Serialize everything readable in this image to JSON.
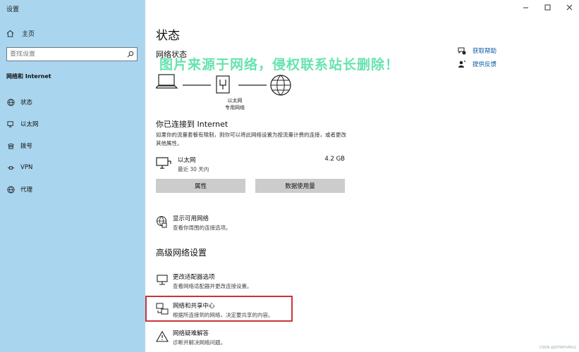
{
  "window": {
    "title": "设置",
    "minimize_glyph": "—",
    "maximize_glyph": "□",
    "close_glyph": "✕"
  },
  "sidebar": {
    "home_label": "主页",
    "search_placeholder": "查找设置",
    "section_title": "网络和 Internet",
    "items": [
      {
        "label": "状态",
        "icon": "globe-icon"
      },
      {
        "label": "以太网",
        "icon": "monitor-icon"
      },
      {
        "label": "拨号",
        "icon": "phone-icon"
      },
      {
        "label": "VPN",
        "icon": "vpn-icon"
      },
      {
        "label": "代理",
        "icon": "globe-icon"
      }
    ]
  },
  "main": {
    "title": "状态",
    "network_status_heading": "网络状态",
    "watermark": "图片来源于网络，侵权联系站长删除！",
    "diagram_caption_line1": "以太网",
    "diagram_caption_line2": "专用网络",
    "connected_heading": "你已连接到 Internet",
    "connected_desc": "如果你的流量套餐有限制，则你可以将此网络设置为按流量计费的连接，或者更改其他属性。",
    "ethernet": {
      "name": "以太网",
      "sub": "最近 30 天内",
      "size": "4.2 GB"
    },
    "buttons": {
      "properties": "属性",
      "data_usage": "数据使用量"
    },
    "show_networks": {
      "title": "显示可用网络",
      "desc": "查看你周围的连接选项。"
    },
    "advanced_heading": "高级网络设置",
    "adapter_options": {
      "title": "更改适配器选项",
      "desc": "查看网络适配器并更改连接设置。"
    },
    "sharing_center": {
      "title": "网络和共享中心",
      "desc": "根据所连接到的网络，决定要共享的内容。"
    },
    "troubleshooter": {
      "title": "网络疑难解答",
      "desc": "诊断并解决网络问题。"
    }
  },
  "help": {
    "get_help": "获取帮助",
    "feedback": "提供反馈"
  },
  "credit": "CSDN @IDYWHVMLG",
  "colors": {
    "sidebar_bg": "#a9d6ee",
    "link": "#0b5aa8",
    "highlight": "#c9343b",
    "watermark": "#5ee2a8",
    "button_bg": "#cccccc"
  }
}
